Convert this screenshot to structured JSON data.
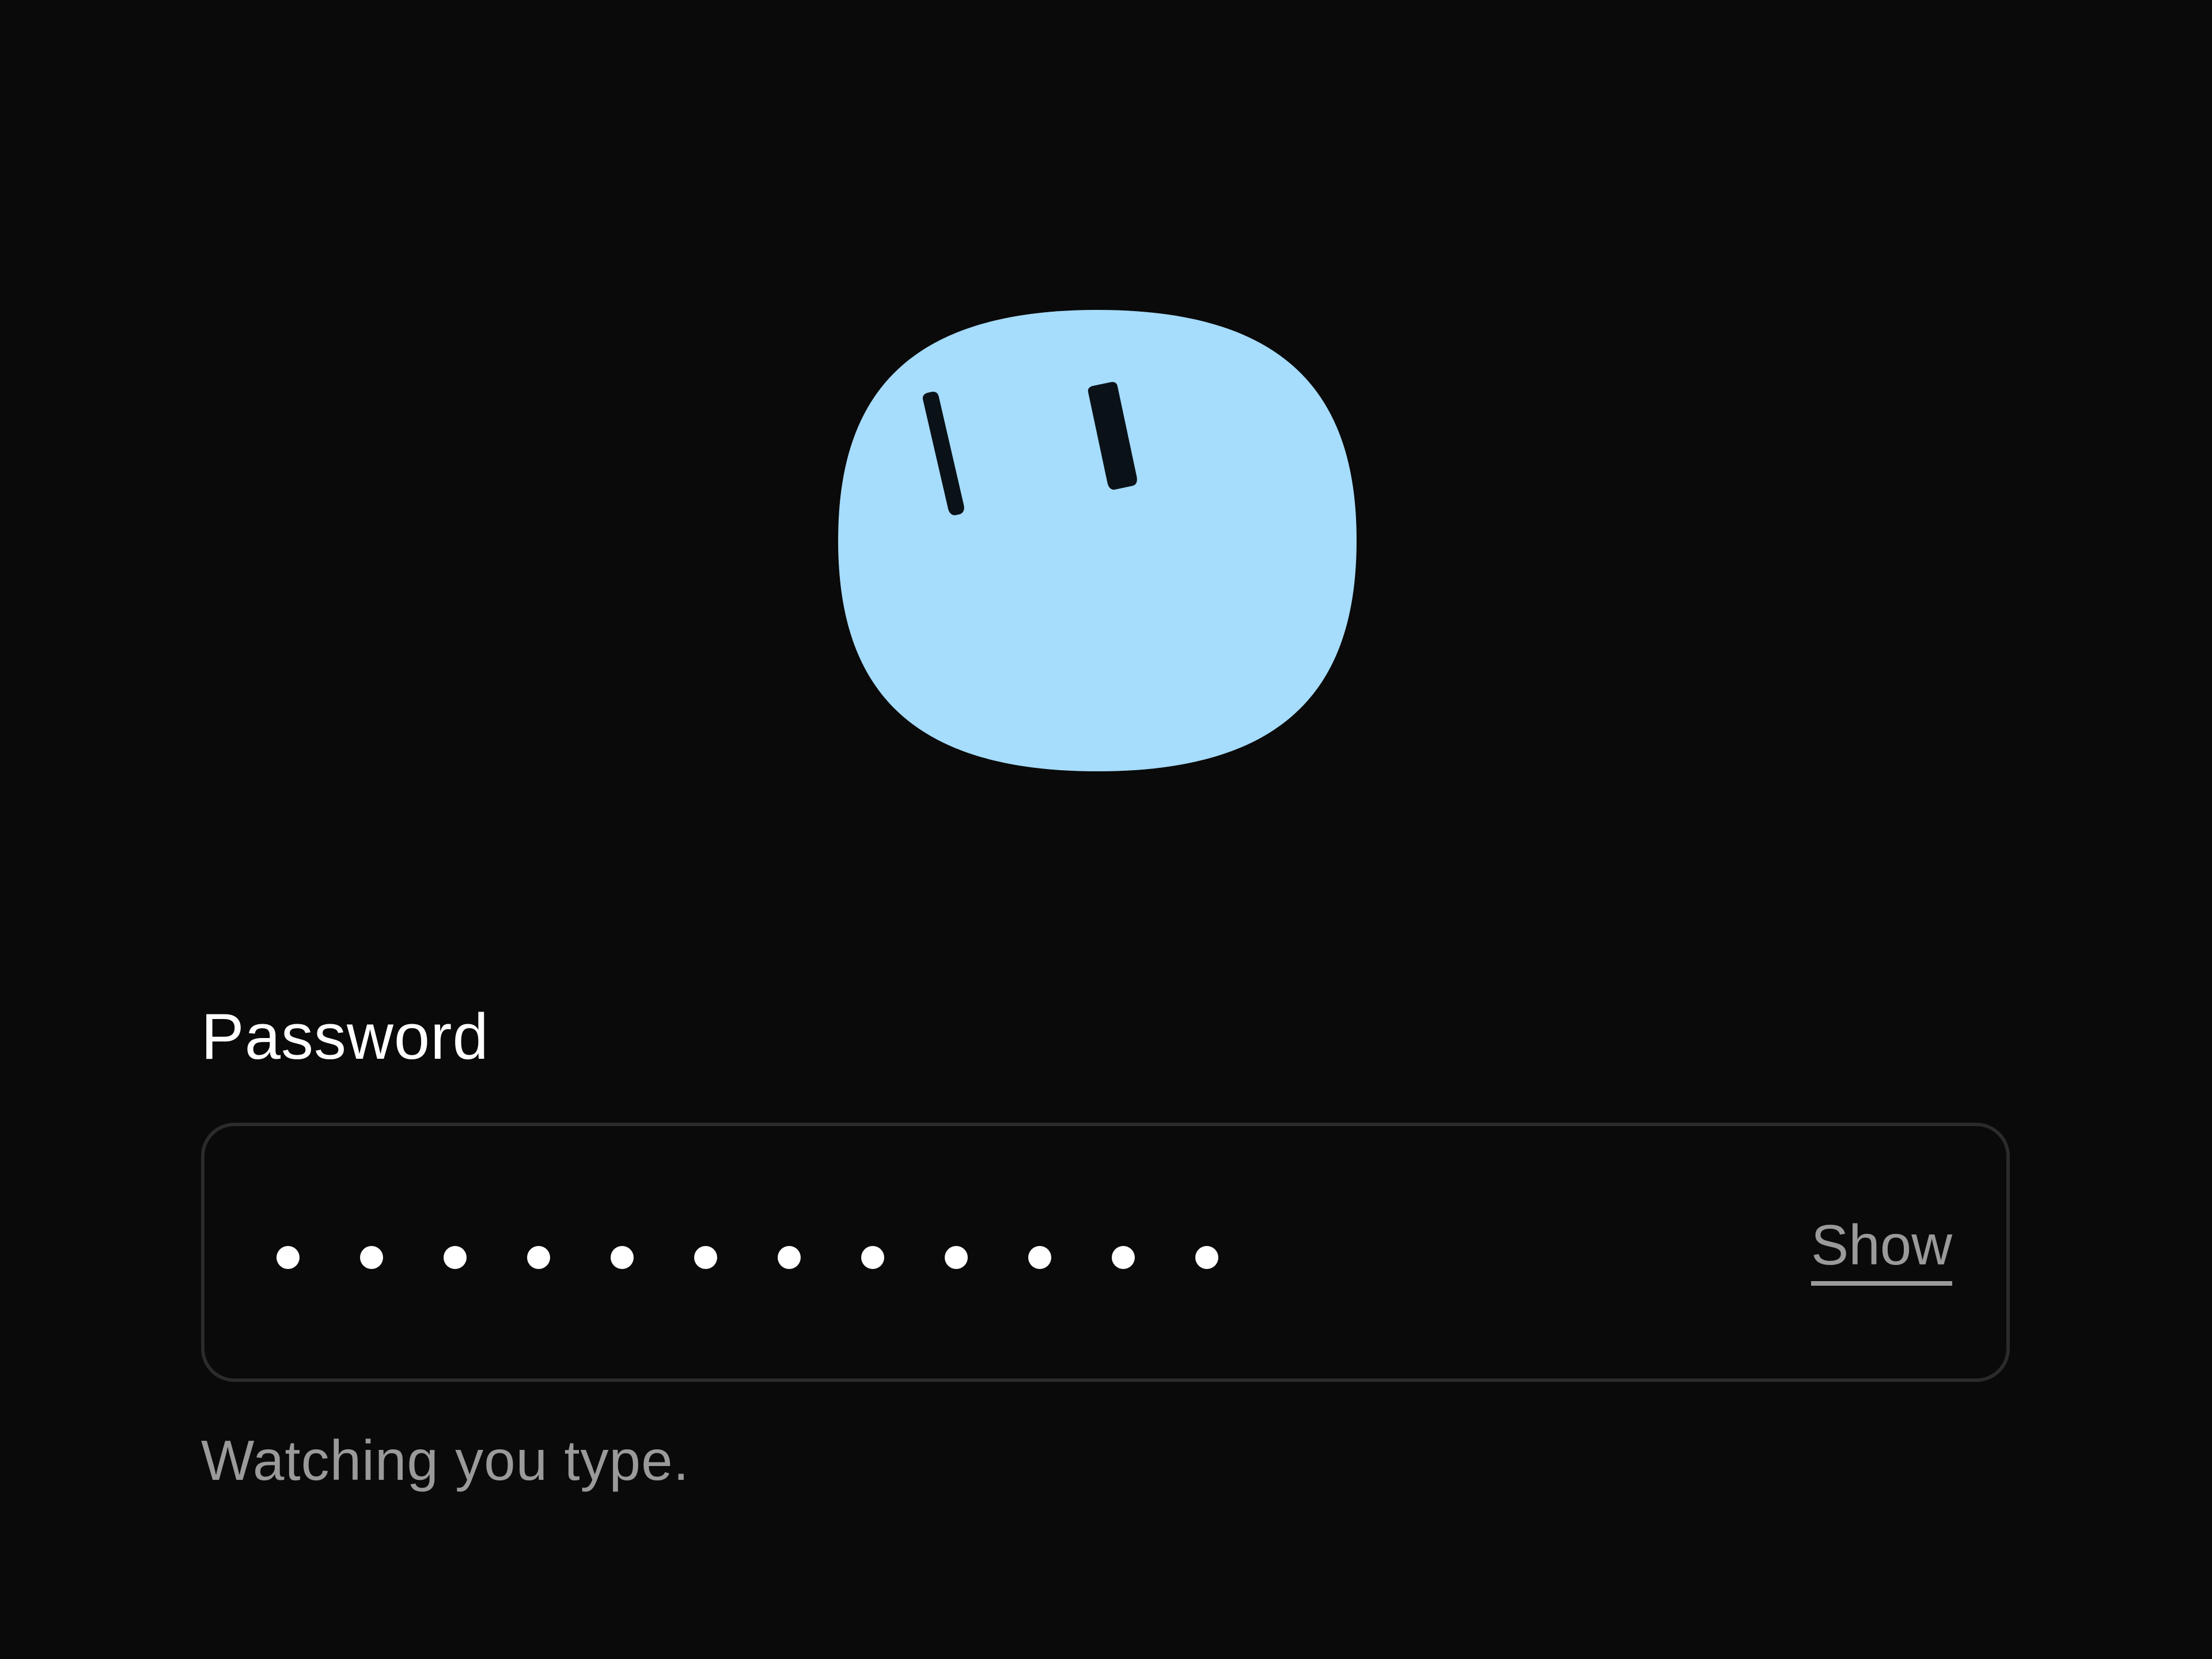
{
  "mascot": {
    "icon": "blob-face-icon",
    "body_color": "#a6dcfc",
    "eye_color": "#0a1218"
  },
  "password_field": {
    "label": "Password",
    "masked_value": "••••••••••••",
    "char_count": 12,
    "show_label": "Show",
    "hint": "Watching you type."
  },
  "colors": {
    "background": "#0a0a0a",
    "border": "#2b2b2b",
    "text": "#ffffff",
    "muted_text": "#9a9a9a"
  }
}
